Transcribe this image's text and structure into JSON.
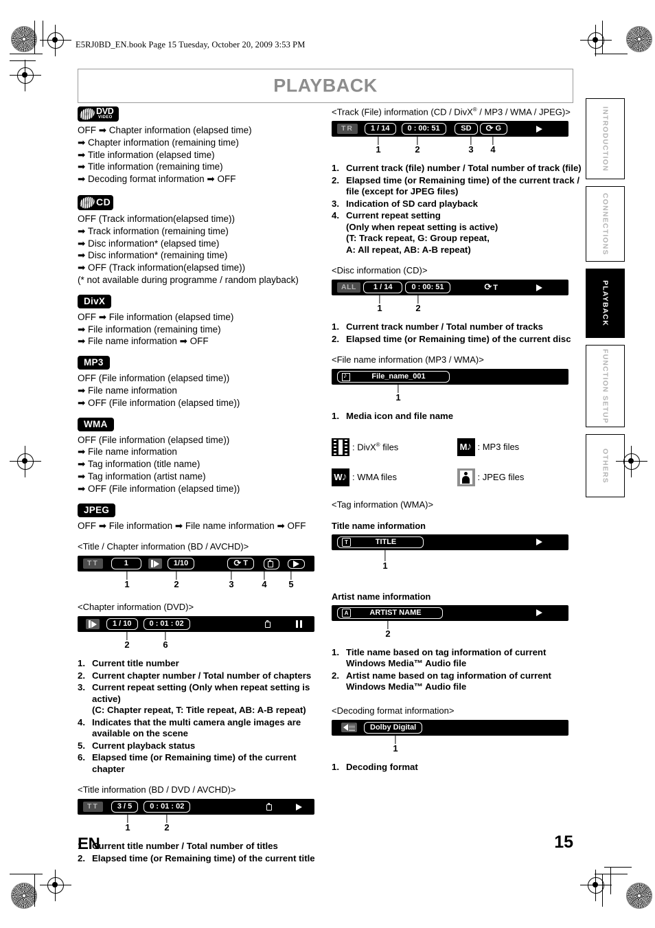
{
  "page": {
    "header_text": "E5RJ0BD_EN.book  Page 15  Tuesday, October 20, 2009  3:53 PM",
    "title": "PLAYBACK",
    "lang_code": "EN",
    "page_number": "15"
  },
  "side_tabs": [
    {
      "label": "INTRODUCTION",
      "active": false
    },
    {
      "label": "CONNECTIONS",
      "active": false
    },
    {
      "label": "PLAYBACK",
      "active": true
    },
    {
      "label": "FUNCTION SETUP",
      "active": false
    },
    {
      "label": "OTHERS",
      "active": false
    }
  ],
  "left_column": {
    "dvd": {
      "badge_main": "DVD",
      "badge_sub": "VIDEO",
      "lines": [
        "OFF ➡ Chapter information (elapsed time)",
        "➡ Chapter information (remaining time)",
        "➡ Title information (elapsed time)",
        "➡ Title information (remaining time)",
        "➡ Decoding format information ➡ OFF"
      ]
    },
    "cd": {
      "badge_main": "CD",
      "lines": [
        "OFF (Track information(elapsed time))",
        "➡ Track information (remaining time)",
        "➡ Disc information* (elapsed time)",
        "➡ Disc information* (remaining time)",
        "➡ OFF (Track information(elapsed time))",
        "(* not available during programme / random playback)"
      ]
    },
    "divx": {
      "badge": "DivX",
      "lines": [
        "OFF ➡ File information (elapsed time)",
        "➡ File information (remaining time)",
        "➡ File name information ➡ OFF"
      ]
    },
    "mp3": {
      "badge": "MP3",
      "lines": [
        "OFF (File information (elapsed time))",
        "➡ File name information",
        "➡ OFF (File information (elapsed time))"
      ]
    },
    "wma": {
      "badge": "WMA",
      "lines": [
        "OFF (File information (elapsed time))",
        "➡ File name information",
        "➡ Tag information (title name)",
        "➡ Tag information (artist name)",
        "➡ OFF (File information (elapsed time))"
      ]
    },
    "jpeg": {
      "badge": "JPEG",
      "lines": [
        "OFF ➡ File information ➡ File name information ➡ OFF"
      ]
    },
    "title_chapter_bd": {
      "caption": "<Title / Chapter information (BD / AVCHD)>",
      "osd": {
        "tt_label": "TT",
        "title_no": "1",
        "chapter": "1/10",
        "repeat": "T",
        "angle_icon": "angle-icon",
        "status_icon": "play-icon"
      },
      "callouts": [
        "1",
        "2",
        "3",
        "4",
        "5"
      ]
    },
    "chapter_dvd": {
      "caption": "<Chapter information (DVD)>",
      "osd": {
        "chapter": "1 / 10",
        "time": "0 : 01 : 02",
        "angle_icon": "angle-icon",
        "status_icon": "pause-icon"
      },
      "callouts": [
        "2",
        "6"
      ]
    },
    "notes_1": [
      {
        "n": "1.",
        "t": "Current title number"
      },
      {
        "n": "2.",
        "t": "Current chapter number / Total number of chapters"
      },
      {
        "n": "3.",
        "t": "Current repeat setting (Only when repeat setting is active)\n(C: Chapter repeat, T: Title repeat, AB: A-B repeat)"
      },
      {
        "n": "4.",
        "t": "Indicates that the multi camera angle images are available on the scene"
      },
      {
        "n": "5.",
        "t": "Current playback status"
      },
      {
        "n": "6.",
        "t": "Elapsed time (or Remaining time) of the current chapter"
      }
    ],
    "title_info_bd": {
      "caption": "<Title information (BD / DVD / AVCHD)>",
      "osd": {
        "tt_label": "TT",
        "title": "3 / 5",
        "time": "0 : 01 : 02",
        "angle_icon": "angle-icon",
        "status_icon": "play-icon"
      },
      "callouts": [
        "1",
        "2"
      ]
    },
    "notes_2": [
      {
        "n": "1.",
        "t": "Current title number / Total number of titles"
      },
      {
        "n": "2.",
        "t": "Elapsed time (or Remaining time) of the current title"
      }
    ]
  },
  "right_column": {
    "track_file": {
      "caption": "<Track (File) information (CD / DivX® / MP3 / WMA / JPEG)>",
      "osd": {
        "tr_label": "TR",
        "track": "1 / 14",
        "time": "0 : 00: 51",
        "sd": "SD",
        "repeat": "G",
        "status_icon": "play-icon"
      },
      "callouts": [
        "1",
        "2",
        "3",
        "4"
      ],
      "notes": [
        {
          "n": "1.",
          "t": "Current track (file) number / Total number of track (file)"
        },
        {
          "n": "2.",
          "t": "Elapsed time (or Remaining time) of the current track / file (except for JPEG files)"
        },
        {
          "n": "3.",
          "t": " Indication of SD card playback"
        },
        {
          "n": "4.",
          "t": "Current repeat setting\n(Only when repeat setting is active)\n(T:  Track repeat, G: Group repeat,\nA: All repeat, AB: A-B repeat)"
        }
      ]
    },
    "disc_cd": {
      "caption": "<Disc information (CD)>",
      "osd": {
        "all_label": "ALL",
        "track": "1 / 14",
        "time": "0 : 00: 51",
        "repeat": "T",
        "status_icon": "play-icon"
      },
      "callouts": [
        "1",
        "2"
      ],
      "notes": [
        {
          "n": "1.",
          "t": "Current track number / Total number of tracks"
        },
        {
          "n": "2.",
          "t": "Elapsed time (or Remaining time) of the current disc"
        }
      ]
    },
    "file_name": {
      "caption": "<File name information (MP3 / WMA)>",
      "osd": {
        "icon": "note-icon",
        "file_name": "File_name_001"
      },
      "callouts": [
        "1"
      ],
      "notes": [
        {
          "n": "1.",
          "t": "Media icon and file name"
        }
      ]
    },
    "media_legend": [
      {
        "icon": "film-icon",
        "label": ": DivX® files"
      },
      {
        "icon": "mp3-note-icon",
        "label": ": MP3 files"
      },
      {
        "icon": "wma-note-icon",
        "label": ": WMA files"
      },
      {
        "icon": "jpeg-picture-icon",
        "label": ": JPEG files"
      }
    ],
    "tag_wma": {
      "caption": "<Tag information (WMA)>",
      "title_subhead": "Title name information",
      "title_osd": {
        "icon": "T",
        "text": "TITLE",
        "status_icon": "play-icon"
      },
      "title_callouts": [
        "1"
      ],
      "artist_subhead": "Artist name information",
      "artist_osd": {
        "icon": "A",
        "text": "ARTIST NAME",
        "status_icon": "play-icon"
      },
      "artist_callouts": [
        "2"
      ],
      "notes": [
        {
          "n": "1.",
          "t": "Title name based on tag information of current Windows Media™ Audio file"
        },
        {
          "n": "2.",
          "t": "Artist name based on tag information of current Windows Media™ Audio file"
        }
      ]
    },
    "decoding": {
      "caption": "<Decoding format information>",
      "osd": {
        "icon": "speaker-icon",
        "format": "Dolby Digital"
      },
      "callouts": [
        "1"
      ],
      "notes": [
        {
          "n": "1.",
          "t": "Decoding format"
        }
      ]
    }
  }
}
